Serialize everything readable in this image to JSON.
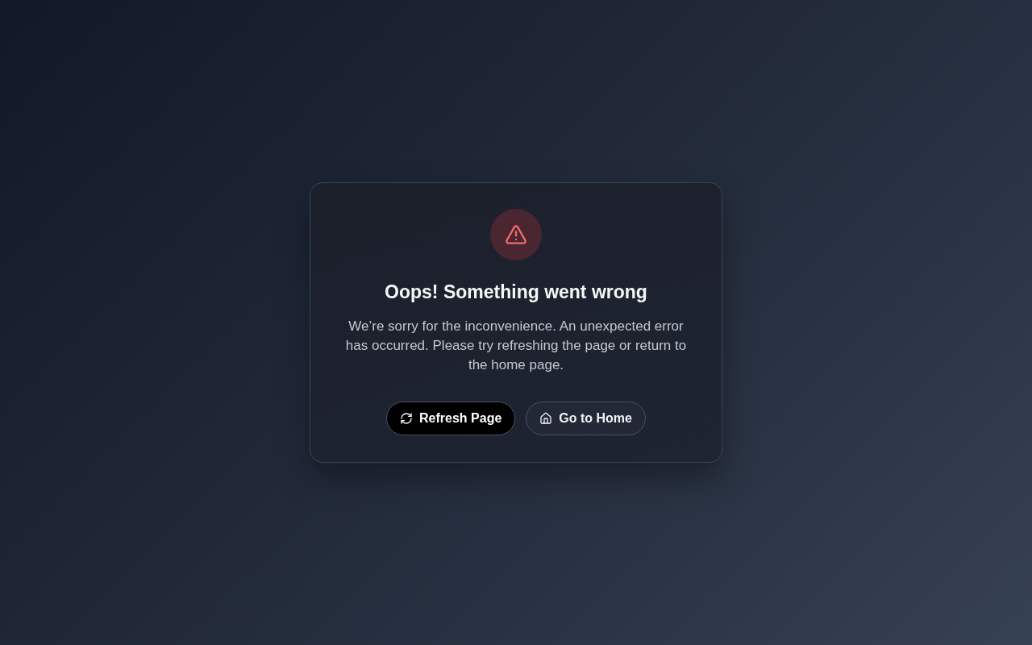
{
  "error_card": {
    "title": "Oops! Something went wrong",
    "message": "We’re sorry for the inconvenience. An unexpected error has occurred. Please try refreshing the page or return to the home page.",
    "buttons": [
      {
        "label": "Refresh Page",
        "kind": "primary"
      },
      {
        "label": "Go to Home",
        "kind": "secondary"
      }
    ]
  }
}
